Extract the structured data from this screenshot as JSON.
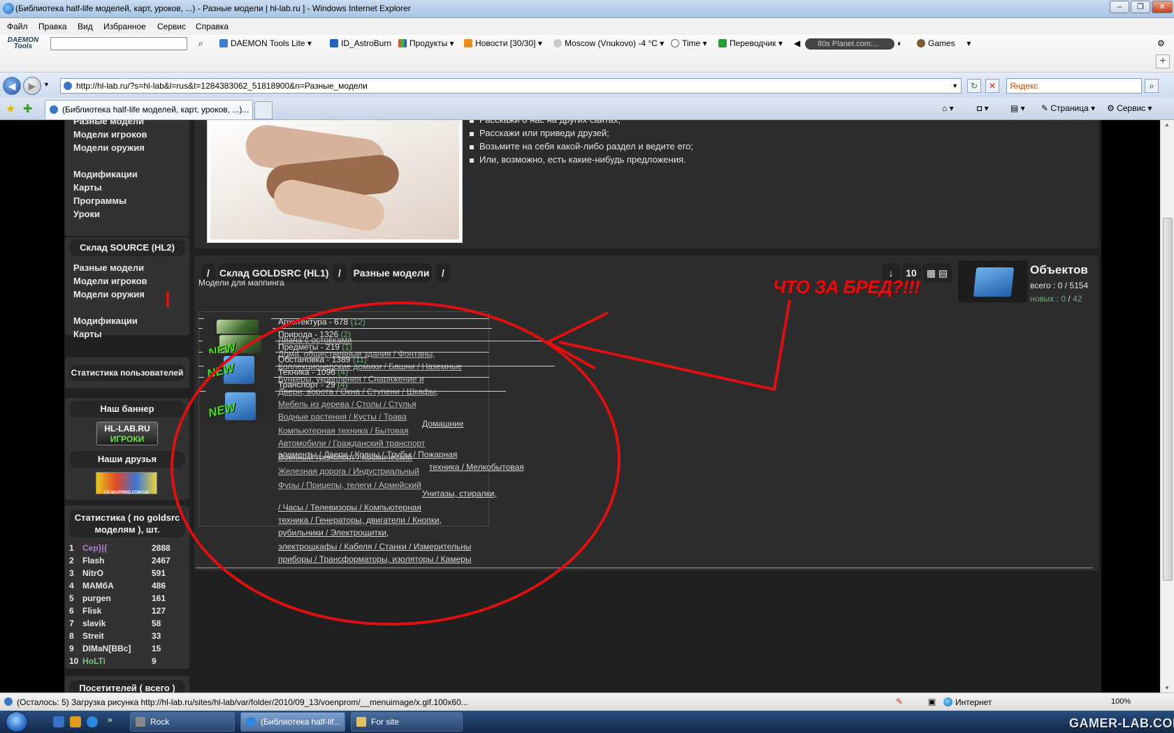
{
  "window": {
    "title": "(Библиотека half-life моделей, карт, уроков, ...) - Разные модели | hl-lab.ru ] - Windows Internet Explorer"
  },
  "menu": [
    "Файл",
    "Правка",
    "Вид",
    "Избранное",
    "Сервис",
    "Справка"
  ],
  "toolbar": {
    "daemon_logo": "DAEMON Tools",
    "items": {
      "daemon": "DAEMON Tools Lite",
      "astroburn": "ID_AstroBurn",
      "products": "Продукты",
      "news": "Новости [30/30]",
      "weather": "Moscow (Vnukovo) -4 °C",
      "time": "Time",
      "translator": "Переводчик",
      "radio": "80s Planet.com:...",
      "games": "Games"
    }
  },
  "address": {
    "url": "http://hl-lab.ru/?s=hl-lab&l=rus&t=1284383062_51818900&n=Разные_модели",
    "search_placeholder": "Яндекс"
  },
  "tab": {
    "label": "(Библиотека half-life моделей, карт, уроков, ...)...",
    "page_menu": "Страница",
    "tools_menu": "Сервис"
  },
  "sidebar": {
    "top_links": [
      "Разные модели",
      "Модели игроков",
      "Модели оружия"
    ],
    "more_links": [
      "Модификации",
      "Карты",
      "Программы",
      "Уроки"
    ],
    "source_head": "Склад SOURCE (HL2)",
    "source_links": [
      "Разные модели",
      "Модели игроков",
      "Модели оружия"
    ],
    "source_more": [
      "Модификации",
      "Карты"
    ],
    "user_stats_head": "Статистика пользователей",
    "banner_head": "Наш баннер",
    "banner_line1": "HL-LAB.RU",
    "banner_line2": "ИГРОКИ",
    "friends_head": "Наши друзья",
    "friends_banner": "CS-MAPPING.COM.UA",
    "stats_head": "Статистика ( по goldsrc моделям ), шт.",
    "stats": [
      {
        "rank": "1",
        "name": "Cep}|{",
        "count": "2888",
        "color": "#b77bd0"
      },
      {
        "rank": "2",
        "name": "Flash",
        "count": "2467",
        "color": "#e8e8e8"
      },
      {
        "rank": "3",
        "name": "NitrO",
        "count": "591",
        "color": "#e8e8e8"
      },
      {
        "rank": "4",
        "name": "MAMбA",
        "count": "486",
        "color": "#e8e8e8"
      },
      {
        "rank": "5",
        "name": "purgen",
        "count": "161",
        "color": "#e8e8e8"
      },
      {
        "rank": "6",
        "name": "Flisk",
        "count": "127",
        "color": "#e8e8e8"
      },
      {
        "rank": "7",
        "name": "slavik",
        "count": "58",
        "color": "#e8e8e8"
      },
      {
        "rank": "8",
        "name": "Streit",
        "count": "33",
        "color": "#e8e8e8"
      },
      {
        "rank": "9",
        "name": "DIMaN[BBc]",
        "count": "15",
        "color": "#e8e8e8"
      },
      {
        "rank": "10",
        "name": "HoLTi",
        "count": "9",
        "color": "#7fc47f"
      }
    ],
    "visitors_head": "Посетителей ( всего )"
  },
  "intro": {
    "bullets": [
      "Расскажи о нас на других сайтах;",
      "Расскажи или приведи друзей;",
      "Возьмите на себя какой-либо раздел и ведите его;",
      "Или, возможно, есть какие-нибудь предложения."
    ]
  },
  "breadcrumb": {
    "sep": "/",
    "store": "Склад GOLDSRC (HL1)",
    "section": "Разные модели",
    "subtitle": "Модели для маппинга"
  },
  "tools": {
    "sort": "↓",
    "per_page": "10"
  },
  "objects": {
    "title": "Объектов",
    "total_label": "всего :",
    "total_a": "0",
    "total_b": "5154",
    "new_label": "новых :",
    "new_a": "0",
    "new_b": "42",
    "slash": "/"
  },
  "annotation": "ЧТО ЗА БРЕД?!!!",
  "badge_new": "NEW",
  "categories": [
    {
      "name": "Архитектура - 678",
      "count": "(12)"
    },
    {
      "name": "Природа - 1326",
      "count": "(2)"
    },
    {
      "name": "Предметы - 219",
      "count": "(1)"
    },
    {
      "name": "Обстановка - 1389",
      "count": "(11)"
    },
    {
      "name": "Техника - 1096",
      "count": "(4)"
    },
    {
      "name": "Транспорт - 29",
      "count": "(4)"
    }
  ],
  "ghost_lines": [
    "Лиана с остовками",
    "Дома, общественные здания / Фонтаны,",
    "Коллекционерские домики / Башни / Наземные",
    "Бункеры, укрепления / Снаряжение и",
    "Двери, ворота / Окна / Ступени / Шкафы,",
    "Мебель из дерева / Столы / Стулья",
    "Водные растения / Кусты / Трава",
    "Компьютерная техника / Бытовая",
    "Автомобили / Гражданский транспорт",
    "Военный транспорт / Космический",
    "Железная дорога / Индустриальный",
    "Фуры / Прицепы, телеги / Армейский"
  ],
  "sub_links": [
    "Домашние",
    "элементы / Двери / Краны / Трубы / Пожарная",
    "техника / Мелкобытовая",
    "Унитазы, стиралки,",
    "/ Часы / Телевизоры / Компьютерная",
    "техника / Генераторы, двигатели / Кнопки,",
    "рубильники / Электрощитки,",
    "электрощкафы / Кабеля / Станки / Измерительны",
    "приборы / Трансформаторы, изоляторы / Камеры"
  ],
  "status": {
    "text": "(Осталось: 5) Загрузка рисунка http://hl-lab.ru/sites/hl-lab/var/folder/2010/09_13/voenprom/__menuimage/x.gif.100x60...",
    "zone": "Интернет",
    "zoom": "100%"
  },
  "taskbar": {
    "items": [
      "Rock",
      "(Библиотека half-lif...",
      "For site"
    ],
    "watermark": "GAMER-LAB.COM"
  }
}
